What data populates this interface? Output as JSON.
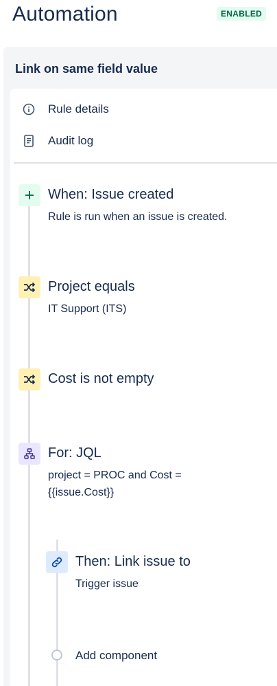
{
  "header": {
    "title": "Automation",
    "status_badge": "ENABLED"
  },
  "rule": {
    "name": "Link on same field value"
  },
  "menu": {
    "items": [
      {
        "label": "Rule details",
        "icon": "info-icon"
      },
      {
        "label": "Audit log",
        "icon": "document-icon"
      }
    ]
  },
  "components": {
    "trigger": {
      "title": "When: Issue created",
      "description": "Rule is run when an issue is created.",
      "icon": "plus-icon",
      "color": "#e3fcef"
    },
    "condition1": {
      "title": "Project equals",
      "description": "IT Support (ITS)",
      "icon": "shuffle-icon",
      "color": "#fff0b3"
    },
    "condition2": {
      "title": "Cost is not empty",
      "icon": "shuffle-icon",
      "color": "#fff0b3"
    },
    "branch": {
      "title": "For: JQL",
      "description_line1": "project = PROC and Cost =",
      "description_line2": "{{issue.Cost}}",
      "icon": "branch-icon",
      "color": "#eae6ff"
    },
    "action": {
      "title": "Then: Link issue to",
      "description": "Trigger issue",
      "icon": "link-icon",
      "color": "#deebff"
    },
    "add_component": {
      "label": "Add component"
    }
  },
  "colors": {
    "accent_text": "#172b4d",
    "badge_bg": "#e3fcef",
    "badge_text": "#006644",
    "panel_bg": "#f4f5f7"
  }
}
